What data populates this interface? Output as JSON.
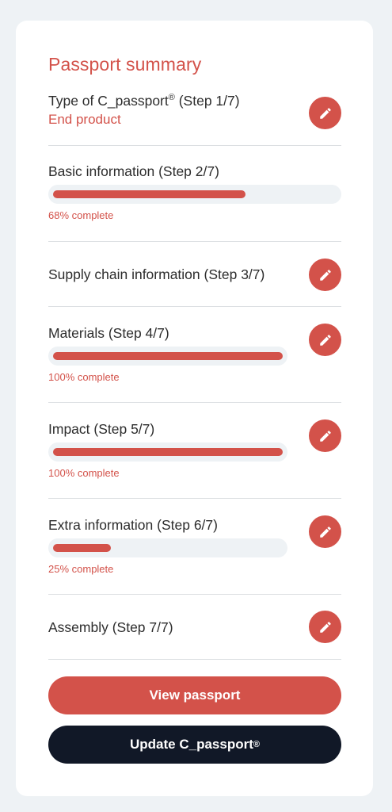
{
  "title": "Passport summary",
  "steps": [
    {
      "label": "Type of C_passport",
      "label_sup": "®",
      "label_suffix": " (Step 1/7)",
      "sub": "End product"
    },
    {
      "label": "Basic information (Step 2/7)",
      "progress": 0.68,
      "progress_text": "68% complete"
    },
    {
      "label": "Supply chain information (Step 3/7)"
    },
    {
      "label": "Materials (Step 4/7)",
      "progress": 1.0,
      "progress_text": "100% complete"
    },
    {
      "label": "Impact (Step 5/7)",
      "progress": 1.0,
      "progress_text": "100% complete"
    },
    {
      "label": "Extra information (Step 6/7)",
      "progress": 0.25,
      "progress_text": "25% complete"
    },
    {
      "label": "Assembly (Step 7/7)"
    }
  ],
  "buttons": {
    "view": "View passport",
    "update": "Update C_passport",
    "update_sup": "®"
  },
  "colors": {
    "accent": "#d3524a",
    "dark": "#111827",
    "track": "#eef2f5"
  },
  "icons": {
    "edit": "pencil-icon"
  }
}
